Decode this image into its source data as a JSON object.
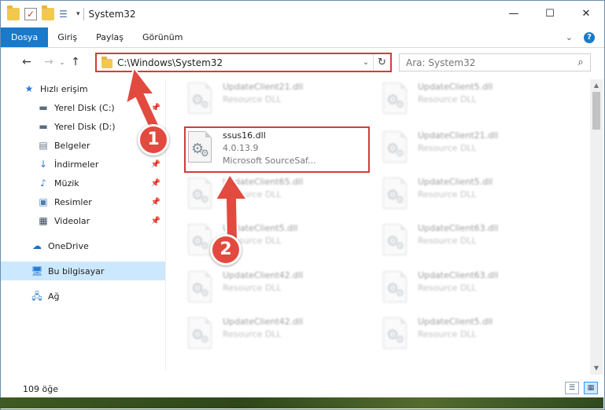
{
  "title": "System32",
  "quick_access_icons": [
    "folder-icon",
    "properties-check-icon",
    "folder-icon",
    "properties-icon",
    "customize-caret-icon"
  ],
  "window_controls": {
    "minimize": "—",
    "maximize": "☐",
    "close": "✕"
  },
  "ribbon": {
    "tabs": [
      "Dosya",
      "Giriş",
      "Paylaş",
      "Görünüm"
    ],
    "expand": "⌄",
    "help": "?"
  },
  "nav": {
    "back": "←",
    "forward": "→",
    "recent": "⌄",
    "up": "↑",
    "address": "C:\\Windows\\System32",
    "address_dropdown": "⌄",
    "refresh": "↻",
    "search_placeholder": "Ara: System32",
    "search_icon": "⌕"
  },
  "sidebar": {
    "quick_access": "Hızlı erişim",
    "items": [
      {
        "label": "Yerel Disk (C:)",
        "icon": "disk-icon",
        "pinned": true
      },
      {
        "label": "Yerel Disk (D:)",
        "icon": "disk-icon",
        "pinned": false
      },
      {
        "label": "Belgeler",
        "icon": "documents-icon",
        "pinned": true
      },
      {
        "label": "İndirmeler",
        "icon": "downloads-icon",
        "pinned": true
      },
      {
        "label": "Müzik",
        "icon": "music-icon",
        "pinned": true
      },
      {
        "label": "Resimler",
        "icon": "pictures-icon",
        "pinned": true
      },
      {
        "label": "Videolar",
        "icon": "videos-icon",
        "pinned": true
      }
    ],
    "onedrive": "OneDrive",
    "this_pc": "Bu bilgisayar",
    "network": "Ağ"
  },
  "files": [
    {
      "name": "UpdateClient21.dll",
      "type": "Resource DLL",
      "col": 0,
      "row": 0
    },
    {
      "name": "UpdateClient5.dll",
      "type": "Resource DLL",
      "col": 1,
      "row": 0
    },
    {
      "name": "ssus16.dll",
      "version": "4.0.13.9",
      "company": "Microsoft SourceSaf...",
      "col": 0,
      "row": 1,
      "highlighted": true
    },
    {
      "name": "UpdateClient21.dll",
      "type": "Resource DLL",
      "col": 1,
      "row": 1
    },
    {
      "name": "UpdateClient65.dll",
      "type": "Resource DLL",
      "col": 0,
      "row": 2
    },
    {
      "name": "UpdateClient5.dll",
      "type": "Resource DLL",
      "col": 1,
      "row": 2
    },
    {
      "name": "UpdateClient5.dll",
      "type": "Resource DLL",
      "col": 0,
      "row": 3
    },
    {
      "name": "UpdateClient63.dll",
      "type": "Resource DLL",
      "col": 1,
      "row": 3
    },
    {
      "name": "UpdateClient42.dll",
      "type": "Resource DLL",
      "col": 0,
      "row": 4
    },
    {
      "name": "UpdateClient63.dll",
      "type": "Resource DLL",
      "col": 1,
      "row": 4
    },
    {
      "name": "UpdateClient42.dll",
      "type": "Resource DLL",
      "col": 0,
      "row": 5
    },
    {
      "name": "UpdateClient5.dll",
      "type": "Resource DLL",
      "col": 1,
      "row": 5
    }
  ],
  "annotations": {
    "step1": "1",
    "step2": "2",
    "color": "#e24a3f"
  },
  "status": {
    "item_count": "109 öğe"
  },
  "colors": {
    "accent": "#1979ca",
    "highlight": "#d43b3b",
    "selected": "#cce8ff"
  }
}
